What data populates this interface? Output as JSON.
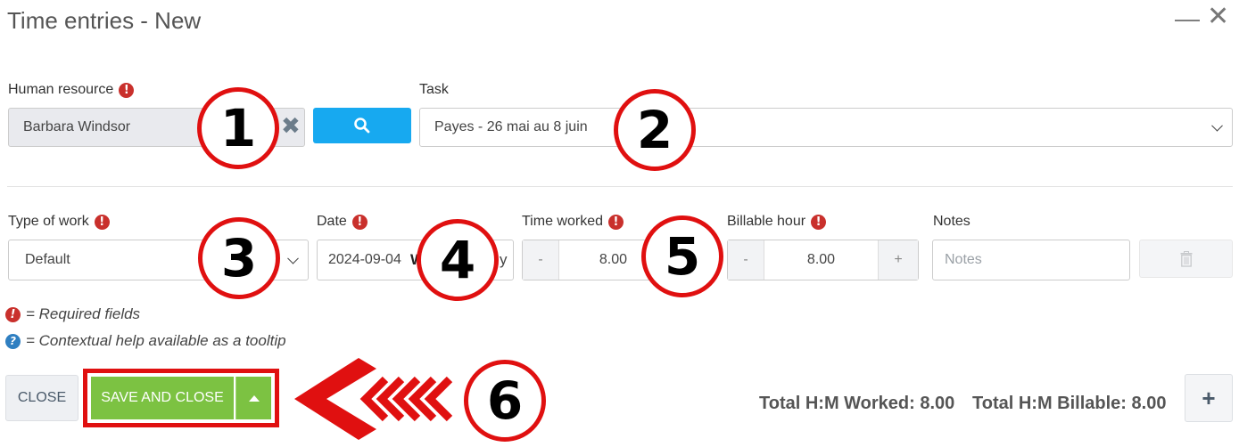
{
  "window": {
    "title": "Time entries - New",
    "minimize_glyph": "—",
    "close_glyph": "✕"
  },
  "human_resource": {
    "label": "Human resource",
    "value": "Barbara Windsor",
    "clear_glyph": "✖",
    "required": true
  },
  "task": {
    "label": "Task",
    "value": "Payes - 26 mai au 8 juin"
  },
  "type_of_work": {
    "label": "Type of work",
    "value": "Default",
    "required": true
  },
  "date": {
    "label": "Date",
    "value": "2024-09-04",
    "weekday_partial_left": "W",
    "weekday_partial_right": "y",
    "required": true
  },
  "time_worked": {
    "label": "Time worked",
    "minus": "-",
    "value": "8.00",
    "required": true
  },
  "billable_hour": {
    "label": "Billable hour",
    "minus": "-",
    "value": "8.00",
    "plus": "+",
    "required": true
  },
  "notes": {
    "label": "Notes",
    "placeholder": "Notes"
  },
  "legend": {
    "required_icon": "!",
    "required_text": "= Required fields",
    "help_icon": "?",
    "help_text": "= Contextual help available as a tooltip"
  },
  "footer": {
    "close_label": "CLOSE",
    "save_label": "SAVE AND CLOSE",
    "total_worked": "Total H:M Worked: 8.00",
    "total_billable": "Total H:M Billable: 8.00",
    "add_label": "+"
  },
  "callouts": [
    "1",
    "2",
    "3",
    "4",
    "5",
    "6"
  ],
  "colors": {
    "accent_blue": "#17a9f0",
    "save_green": "#7cc242",
    "required_red": "#c9302c",
    "annotation_red": "#e01010"
  },
  "icons": [
    "search-icon",
    "trash-icon",
    "clear-icon",
    "chevron-down-icon",
    "caret-up-icon",
    "plus-icon",
    "minimize-icon",
    "close-icon"
  ]
}
